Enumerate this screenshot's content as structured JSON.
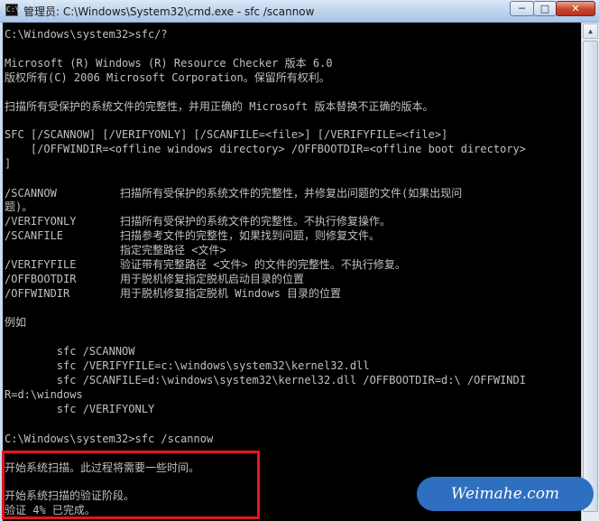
{
  "window": {
    "title": "管理员: C:\\Windows\\System32\\cmd.exe - sfc  /scannow",
    "app_icon_glyph": "C:\\",
    "buttons": {
      "minimize": "─",
      "maximize": "□",
      "close": "✕"
    }
  },
  "console": {
    "lines": [
      "C:\\Windows\\system32>sfc/?",
      "Microsoft (R) Windows (R) Resource Checker 版本 6.0",
      "版权所有(C) 2006 Microsoft Corporation。保留所有权利。",
      "扫描所有受保护的系统文件的完整性，并用正确的 Microsoft 版本替换不正确的版本。",
      "SFC [/SCANNOW] [/VERIFYONLY] [/SCANFILE=<file>] [/VERIFYFILE=<file>]",
      "    [/OFFWINDIR=<offline windows directory> /OFFBOOTDIR=<offline boot directory>",
      "]",
      "题)。",
      "例如",
      "        sfc /SCANNOW",
      "        sfc /VERIFYFILE=c:\\windows\\system32\\kernel32.dll",
      "        sfc /SCANFILE=d:\\windows\\system32\\kernel32.dll /OFFBOOTDIR=d:\\ /OFFWINDI",
      "R=d:\\windows",
      "        sfc /VERIFYONLY",
      "C:\\Windows\\system32>sfc /scannow",
      "开始系统扫描。此过程将需要一些时间。",
      "开始系统扫描的验证阶段。",
      "验证 4% 已完成。"
    ],
    "options": [
      {
        "name": "/SCANNOW",
        "desc": "扫描所有受保护的系统文件的完整性，并修复出问题的文件(如果出现问"
      },
      {
        "name": "/VERIFYONLY",
        "desc": "扫描所有受保护的系统文件的完整性。不执行修复操作。"
      },
      {
        "name": "/SCANFILE",
        "desc": "扫描参考文件的完整性，如果找到问题，则修复文件。"
      },
      {
        "name": "",
        "desc": "指定完整路径 <文件>"
      },
      {
        "name": "/VERIFYFILE",
        "desc": "验证带有完整路径 <文件> 的文件的完整性。不执行修复。"
      },
      {
        "name": "/OFFBOOTDIR",
        "desc": "用于脱机修复指定脱机启动目录的位置"
      },
      {
        "name": "/OFFWINDIR",
        "desc": "用于脱机修复指定脱机 Windows 目录的位置"
      }
    ]
  },
  "watermark": {
    "text": "Weimahe.com"
  },
  "colors": {
    "console_bg": "#000000",
    "console_text": "#c0c0c0",
    "highlight": "#e8141b",
    "watermark_bg": "#2f6fc0"
  }
}
